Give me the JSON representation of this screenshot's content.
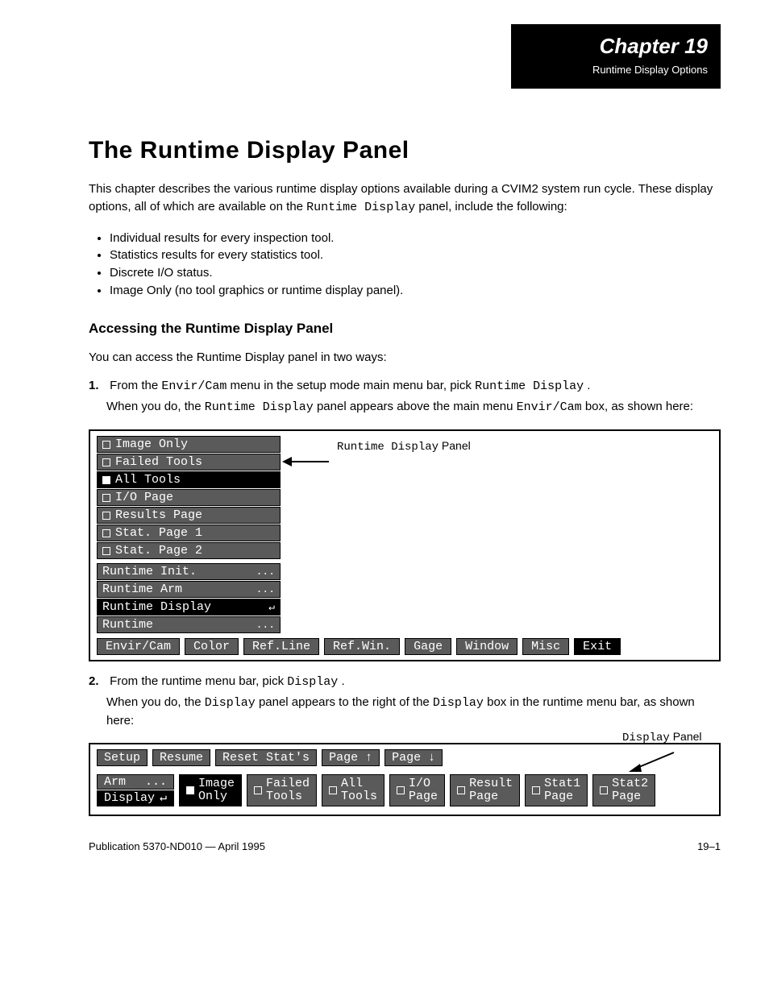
{
  "chapter": {
    "num": "19",
    "title": "Runtime Display Options"
  },
  "section": "The Runtime Display Panel",
  "intro1": "This chapter describes the various runtime display options available during a CVIM2 system run cycle. These display options, all of which are available on the ",
  "intro_kbd": "Runtime Display",
  "intro2": " panel, include the following:",
  "bullets": [
    "Individual results for every inspection tool.",
    "Statistics results for every statistics tool.",
    "Discrete I/O status.",
    "Image Only (no tool graphics or runtime display panel)."
  ],
  "subhead": "Accessing the Runtime Display Panel",
  "access_intro": "You can access the Runtime Display panel in two ways:",
  "steps_a": {
    "n1": "1.",
    "t1a": "From the ",
    "kbd1": "Envir/Cam",
    "t1b": " menu in the setup mode main menu bar, pick ",
    "kbd2": "Runtime Display",
    "t1c": ".",
    "indent1": "When you do, the ",
    "kbd3": "Runtime Display",
    "indent1b": " panel appears above the main menu ",
    "kbd4": "Envir/Cam",
    "indent1c": " box, as shown here:"
  },
  "menu": {
    "items_top": [
      {
        "label": "Image Only",
        "checked": false,
        "selected": false
      },
      {
        "label": "Failed Tools",
        "checked": false,
        "selected": false
      },
      {
        "label": "All Tools",
        "checked": true,
        "selected": true
      },
      {
        "label": "I/O Page",
        "checked": false,
        "selected": false
      },
      {
        "label": "Results Page",
        "checked": false,
        "selected": false
      },
      {
        "label": "Stat. Page 1",
        "checked": false,
        "selected": false
      },
      {
        "label": "Stat. Page 2",
        "checked": false,
        "selected": false
      }
    ],
    "items_mid": [
      {
        "label": "Runtime Init.",
        "tail": "...",
        "selected": false
      },
      {
        "label": "Runtime Arm",
        "tail": "...",
        "selected": false
      },
      {
        "label": "Runtime Display",
        "tail": "↵",
        "selected": true
      },
      {
        "label": "Runtime",
        "tail": "...",
        "selected": false
      }
    ],
    "bottom": [
      "Envir/Cam",
      "Color",
      "Ref.Line",
      "Ref.Win.",
      "Gage",
      "Window",
      "Misc",
      "Exit"
    ],
    "bottom_selected": "Exit",
    "arrow_note": "Runtime Display Panel"
  },
  "steps_b": {
    "n2": "2.",
    "t2a": "From the runtime menu bar, pick ",
    "kbd1": "Display",
    "t2b": ".",
    "indent": "When you do, the ",
    "kbd2": "Display",
    "indent_b": " panel appears to the right of the ",
    "kbd3": "Display",
    "indent_c": " box in the runtime menu bar, as shown here:"
  },
  "shot2": {
    "top": [
      "Setup",
      "Resume",
      "Reset Stat's",
      "Page ↑",
      "Page ↓"
    ],
    "left_col": [
      {
        "line1": "Arm",
        "tail": "...",
        "sel": false
      },
      {
        "line1": "Display",
        "tail": "↵",
        "sel": true
      }
    ],
    "opts": [
      {
        "l1": "Image",
        "l2": "Only",
        "checked": true
      },
      {
        "l1": "Failed",
        "l2": "Tools",
        "checked": false
      },
      {
        "l1": "All",
        "l2": "Tools",
        "checked": false
      },
      {
        "l1": "I/O",
        "l2": "Page",
        "checked": false
      },
      {
        "l1": "Result",
        "l2": "Page",
        "checked": false
      },
      {
        "l1": "Stat1",
        "l2": "Page",
        "checked": false
      },
      {
        "l1": "Stat2",
        "l2": "Page",
        "checked": false
      }
    ],
    "arrow_note": "Display Panel"
  },
  "footer": {
    "left": "Publication 5370-ND010 — April 1995",
    "right": "19–1"
  }
}
